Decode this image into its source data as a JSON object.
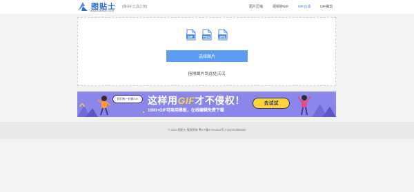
{
  "header": {
    "logo_text": "图贴士",
    "logo_url": "www.tutieshi.com",
    "logo_tag": "[做GIF工具之家]",
    "nav": [
      {
        "label": "图片压缩"
      },
      {
        "label": "视频转GIF"
      },
      {
        "label": "GIF合成"
      },
      {
        "label": "GIF裁剪"
      }
    ],
    "active_nav_color": "#4a8af4"
  },
  "upload": {
    "formats": [
      "GIF",
      "PNG",
      "JPG"
    ],
    "choose_label": "选择图片",
    "drag_hint": "拖拽图片到此处试试"
  },
  "banner": {
    "bubble_text": "我们有一样做GIF",
    "title_pre": "这样用",
    "title_gif": "GIF",
    "title_post": "才不侵权！",
    "subtitle": "1000+GIF可商用模板，在线编辑免费下载",
    "cta_label": "去试试",
    "background_color": "#8b86ea",
    "accent_color": "#ffd43b"
  },
  "footer": {
    "text": "© 2020 图贴士 版权所有 粤ICP备17002912号-2 QQ:514589482"
  }
}
